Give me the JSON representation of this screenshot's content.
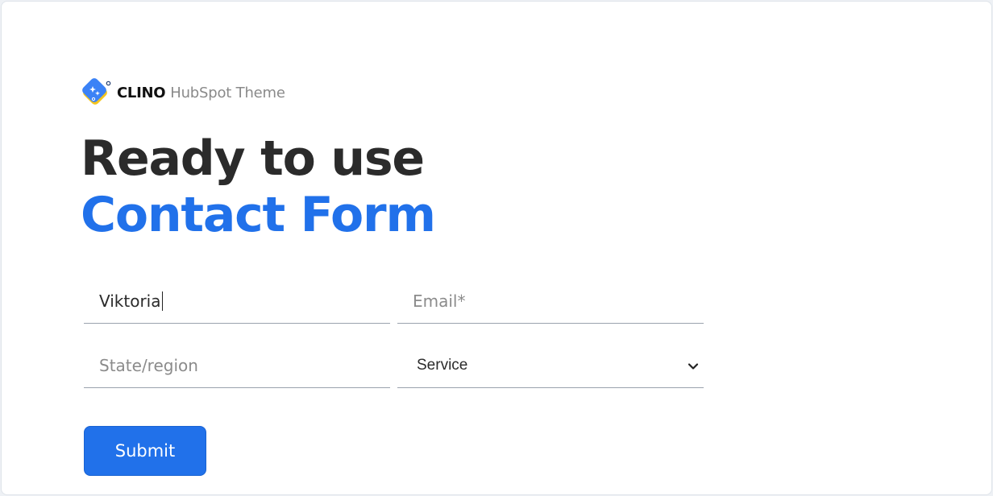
{
  "brand": {
    "name": "CLINO",
    "subtitle": "HubSpot Theme"
  },
  "headline": {
    "line1": "Ready to use",
    "line2": "Contact Form"
  },
  "form": {
    "first_name_value": "Viktoria",
    "email_placeholder": "Email*",
    "state_placeholder": "State/region",
    "service_selected": "Service",
    "submit_label": "Submit"
  },
  "colors": {
    "accent": "#2171ea",
    "heading": "#2b2b2b",
    "logo_yellow": "#f5c51d"
  },
  "icons": {
    "logo": "sparkle-diamond-logo",
    "select": "chevron-down-icon"
  }
}
